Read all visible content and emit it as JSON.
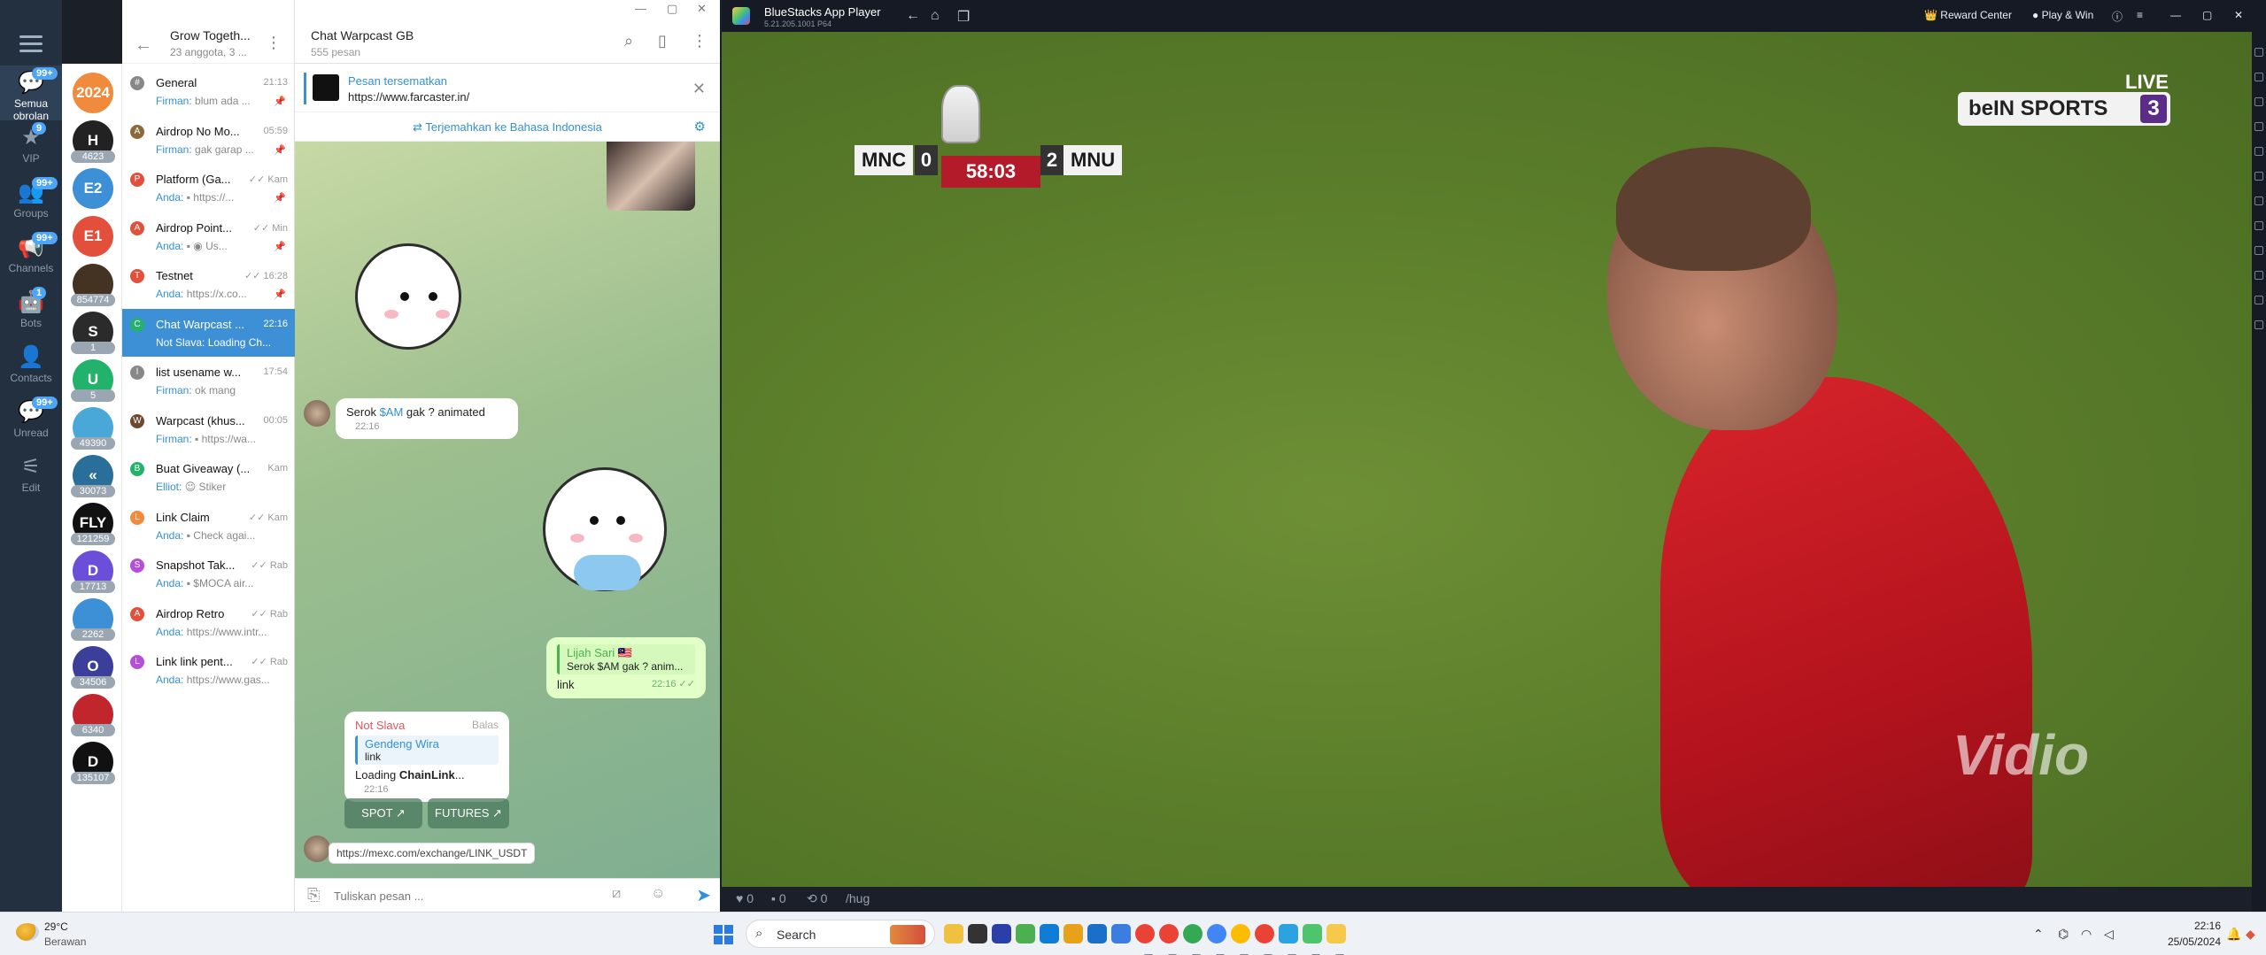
{
  "telegram": {
    "rail": [
      {
        "label": "Semua obrolan",
        "badge": "99+",
        "icon": "chat-bubbles-icon",
        "active": true
      },
      {
        "label": "VIP",
        "badge": "9",
        "icon": "star-icon"
      },
      {
        "label": "Groups",
        "badge": "99+",
        "icon": "group-icon"
      },
      {
        "label": "Channels",
        "badge": "99+",
        "icon": "megaphone-icon"
      },
      {
        "label": "Bots",
        "badge": "1",
        "icon": "robot-icon"
      },
      {
        "label": "Contacts",
        "badge": "",
        "icon": "person-icon"
      },
      {
        "label": "Unread",
        "badge": "99+",
        "icon": "unread-icon"
      },
      {
        "label": "Edit",
        "badge": "",
        "icon": "sliders-icon"
      }
    ],
    "avatars": [
      {
        "text": "2024",
        "color": "#f08a3c",
        "count": ""
      },
      {
        "text": "H",
        "color": "#222222",
        "count": "4623"
      },
      {
        "text": "E2",
        "color": "#3d8fd6",
        "count": ""
      },
      {
        "text": "E1",
        "color": "#e2503c",
        "count": ""
      },
      {
        "text": "",
        "color": "#443322",
        "count": "854774"
      },
      {
        "text": "S",
        "color": "#2b2b2b",
        "count": "1"
      },
      {
        "text": "U",
        "color": "#23b26b",
        "count": "5"
      },
      {
        "text": "",
        "color": "#4aa8d8",
        "count": "49390"
      },
      {
        "text": "«",
        "color": "#2a6f9a",
        "count": "30073"
      },
      {
        "text": "FLY",
        "color": "#111111",
        "count": "121259"
      },
      {
        "text": "D",
        "color": "#6b4fd8",
        "count": "17713"
      },
      {
        "text": "",
        "color": "#3d8fd6",
        "count": "2262"
      },
      {
        "text": "O",
        "color": "#3b3f9a",
        "count": "34506"
      },
      {
        "text": "",
        "color": "#c0262b",
        "count": "6340"
      },
      {
        "text": "D",
        "color": "#111111",
        "count": "135107"
      }
    ],
    "chatlist": {
      "title": "Grow Togeth...",
      "subtitle": "23 anggota, 3 ...",
      "rows": [
        {
          "icon": "#",
          "iconColor": "#888888",
          "name": "General",
          "time": "21:13",
          "sender": "Firman:",
          "preview": "blum ada ...",
          "pinned": true
        },
        {
          "icon": "A",
          "iconColor": "#8a6a3a",
          "name": "Airdrop No Mo...",
          "time": "05:59",
          "sender": "Firman:",
          "preview": "gak garap ...",
          "pinned": true
        },
        {
          "icon": "P",
          "iconColor": "#e2503c",
          "name": "Platform (Ga...",
          "time": "✓✓ Kam",
          "sender": "Anda:",
          "preview": "▪ https://...",
          "pinned": true
        },
        {
          "icon": "A",
          "iconColor": "#e2503c",
          "name": "Airdrop Point...",
          "time": "✓✓ Min",
          "sender": "Anda:",
          "preview": "▪ ◉ Us...",
          "pinned": true
        },
        {
          "icon": "T",
          "iconColor": "#e2503c",
          "name": "Testnet",
          "time": "✓✓ 16:28",
          "sender": "Anda:",
          "preview": "https://x.co...",
          "pinned": true
        },
        {
          "icon": "C",
          "iconColor": "#23b26b",
          "name": "Chat Warpcast ...",
          "time": "22:16",
          "sender": "Not Slava:",
          "preview": "Loading Ch...",
          "pinned": false,
          "active": true
        },
        {
          "icon": "l",
          "iconColor": "#888888",
          "name": "list usename w...",
          "time": "17:54",
          "sender": "Firman:",
          "preview": "ok mang",
          "pinned": false
        },
        {
          "icon": "W",
          "iconColor": "#6b4a30",
          "name": "Warpcast (khus...",
          "time": "00:05",
          "sender": "Firman:",
          "preview": "▪ https://wa...",
          "pinned": false
        },
        {
          "icon": "B",
          "iconColor": "#23b26b",
          "name": "Buat Giveaway (...",
          "time": "Kam",
          "sender": "Elliot:",
          "preview": "😉 Stiker",
          "pinned": false
        },
        {
          "icon": "L",
          "iconColor": "#f08a3c",
          "name": "Link Claim",
          "time": "✓✓ Kam",
          "sender": "Anda:",
          "preview": "▪ Check agai...",
          "pinned": false
        },
        {
          "icon": "S",
          "iconColor": "#b34fd8",
          "name": "Snapshot Tak...",
          "time": "✓✓ Rab",
          "sender": "Anda:",
          "preview": "▪ $MOCA air...",
          "pinned": false
        },
        {
          "icon": "A",
          "iconColor": "#e2503c",
          "name": "Airdrop Retro",
          "time": "✓✓ Rab",
          "sender": "Anda:",
          "preview": "https://www.intr...",
          "pinned": false
        },
        {
          "icon": "L",
          "iconColor": "#b34fd8",
          "name": "Link link pent...",
          "time": "✓✓ Rab",
          "sender": "Anda:",
          "preview": "https://www.gas...",
          "pinned": false
        }
      ]
    },
    "chat": {
      "title": "Chat Warpcast GB",
      "subtitle": "555 pesan",
      "pinned_label": "Pesan tersematkan",
      "pinned_url": "https://www.farcaster.in/",
      "translate": "Terjemahkan ke Bahasa Indonesia",
      "msg1_pre": "Serok ",
      "msg1_link": "$AM",
      "msg1_post": " gak ?  animated",
      "msg1_time": "22:16",
      "reply_name": "Lijah Sari 🇲🇾",
      "reply_text": "Serok $AM gak ?  anim...",
      "out_text": "link",
      "out_time": "22:16 ✓✓",
      "bot_sender": "Not Slava",
      "bot_balas": "Balas",
      "bot_reply_name": "Gendeng Wira",
      "bot_reply_text": "link",
      "bot_text_pre": "Loading ",
      "bot_text_bold": "ChainLink",
      "bot_text_post": "...",
      "bot_time": "22:16",
      "kb1": "SPOT ↗",
      "kb2": "FUTURES ↗",
      "url_chip": "https://mexc.com/exchange/LINK_USDT",
      "composer_placeholder": "Tuliskan pesan ..."
    }
  },
  "bluestacks": {
    "title": "BlueStacks App Player",
    "version": "5.21.205.1001 P64",
    "reward": "👑 Reward Center",
    "play": "● Play & Win",
    "score": {
      "home": "MNC",
      "home_score": "0",
      "away_score": "2",
      "away": "MNU",
      "clock": "58:03"
    },
    "live": "LIVE",
    "channel": "beIN SPORTS",
    "channel_num": "3",
    "watermark": "Vidio",
    "bottom": {
      "likes": "♥ 0",
      "comments": "▪ 0",
      "shares": "⟲ 0",
      "cmd": "/hug"
    }
  },
  "taskbar": {
    "temp": "29°C",
    "weather": "Berawan",
    "search": "Search",
    "time": "22:16",
    "date": "25/05/2024"
  }
}
